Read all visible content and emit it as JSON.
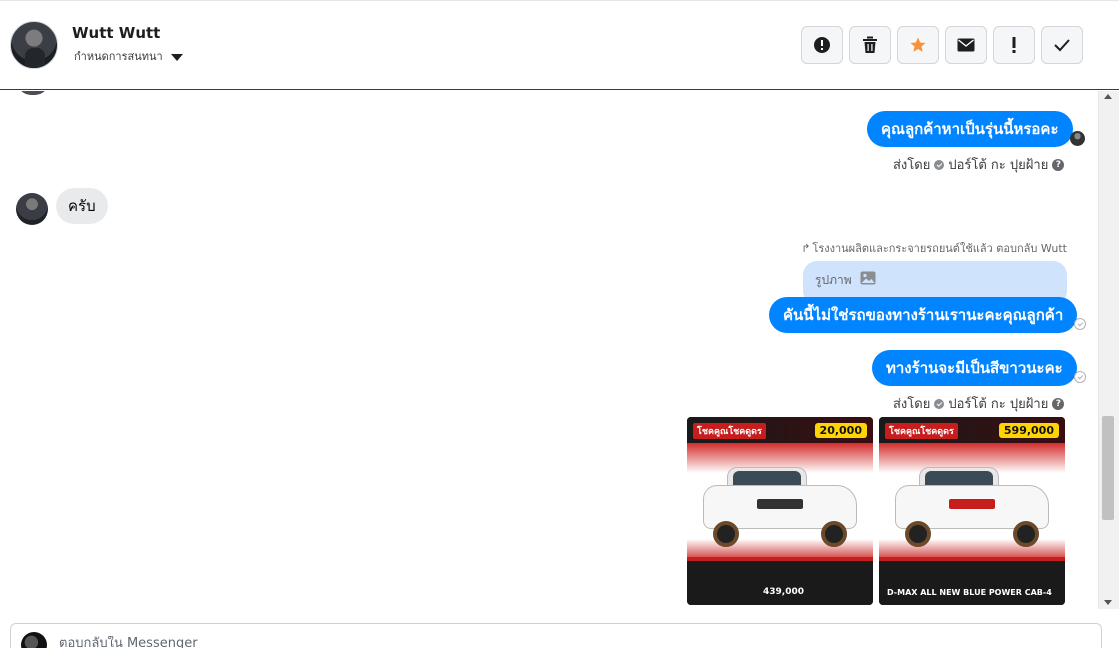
{
  "header": {
    "name": "Wutt Wutt",
    "assign_label": "กำหนดการสนทนา",
    "actions": [
      {
        "icon": "alert-circle-icon"
      },
      {
        "icon": "trash-icon"
      },
      {
        "icon": "star-icon"
      },
      {
        "icon": "envelope-icon"
      },
      {
        "icon": "exclamation-icon"
      },
      {
        "icon": "checkmark-icon"
      }
    ],
    "colors": {
      "star": "#f7923a",
      "border": "#d3d6db"
    }
  },
  "messages": {
    "msg1": "คุณลูกค้าหาเป็นรุ่นนี้หรอคะ",
    "sent_by_prefix": "ส่งโดย",
    "sender_name": "ปอร์โต้ กะ ปุยฝ้าย",
    "reply_in": "ครับ",
    "reply_note": "โรงงานผลิตและกระจายรถยนต์ใช้แล้ว ตอบกลับ Wutt",
    "quoted_label": "รูปภาพ",
    "msg2": "คันนี้ไม่ใช่รถของทางร้านเรานะคะคุณลูกค้า",
    "msg3": "ทางร้านจะมีเป็นสีขาวนะคะ",
    "sent_by_prefix_2": "ส่งโดย",
    "sender_name_2": "ปอร์โต้ กะ ปุยฝ้าย"
  },
  "images": [
    {
      "tag": "โชคคูณโชคดูดร",
      "price": "20,000",
      "footer": "439,000"
    },
    {
      "tag": "โชคคูณโชคดูดร",
      "price": "599,000",
      "footer": "D-MAX ALL NEW BLUE POWER CAB-4"
    }
  ],
  "composer": {
    "placeholder": "ตอบกลับใน Messenger"
  },
  "colors": {
    "outgoing_bubble": "#0084ff",
    "incoming_bubble": "#e9eaec",
    "quote_bubble": "#cfe3fc"
  }
}
